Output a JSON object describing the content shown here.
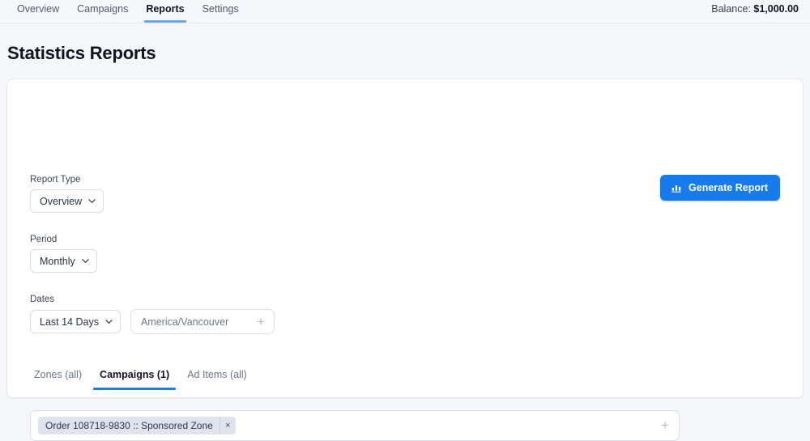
{
  "nav": {
    "items": [
      {
        "label": "Overview",
        "active": false
      },
      {
        "label": "Campaigns",
        "active": false
      },
      {
        "label": "Reports",
        "active": true
      },
      {
        "label": "Settings",
        "active": false
      }
    ],
    "balance_label": "Balance:",
    "balance_value": "$1,000.00"
  },
  "page": {
    "title": "Statistics Reports"
  },
  "form": {
    "report_type": {
      "label": "Report Type",
      "value": "Overview"
    },
    "period": {
      "label": "Period",
      "value": "Monthly"
    },
    "dates": {
      "label": "Dates",
      "range_value": "Last 14 Days",
      "timezone_value": "America/Vancouver",
      "add_icon": "+"
    },
    "generate_button": {
      "label": "Generate Report",
      "icon": "bar-chart-icon"
    }
  },
  "target_tabs": [
    {
      "label": "Zones (all)",
      "active": false
    },
    {
      "label": "Campaigns (1)",
      "active": true
    },
    {
      "label": "Ad Items (all)",
      "active": false
    }
  ],
  "selection": {
    "chips": [
      {
        "label": "Order 108718-9830 :: Sponsored Zone",
        "remove_icon": "×"
      }
    ],
    "add_icon": "+"
  },
  "colors": {
    "accent_blue": "#177bec",
    "nav_underline": "#6aaaea",
    "tab_underline": "#1a7cf0",
    "page_bg": "#f4f6f9",
    "card_bg": "#ffffff",
    "chip_bg": "#dfe3ed"
  }
}
